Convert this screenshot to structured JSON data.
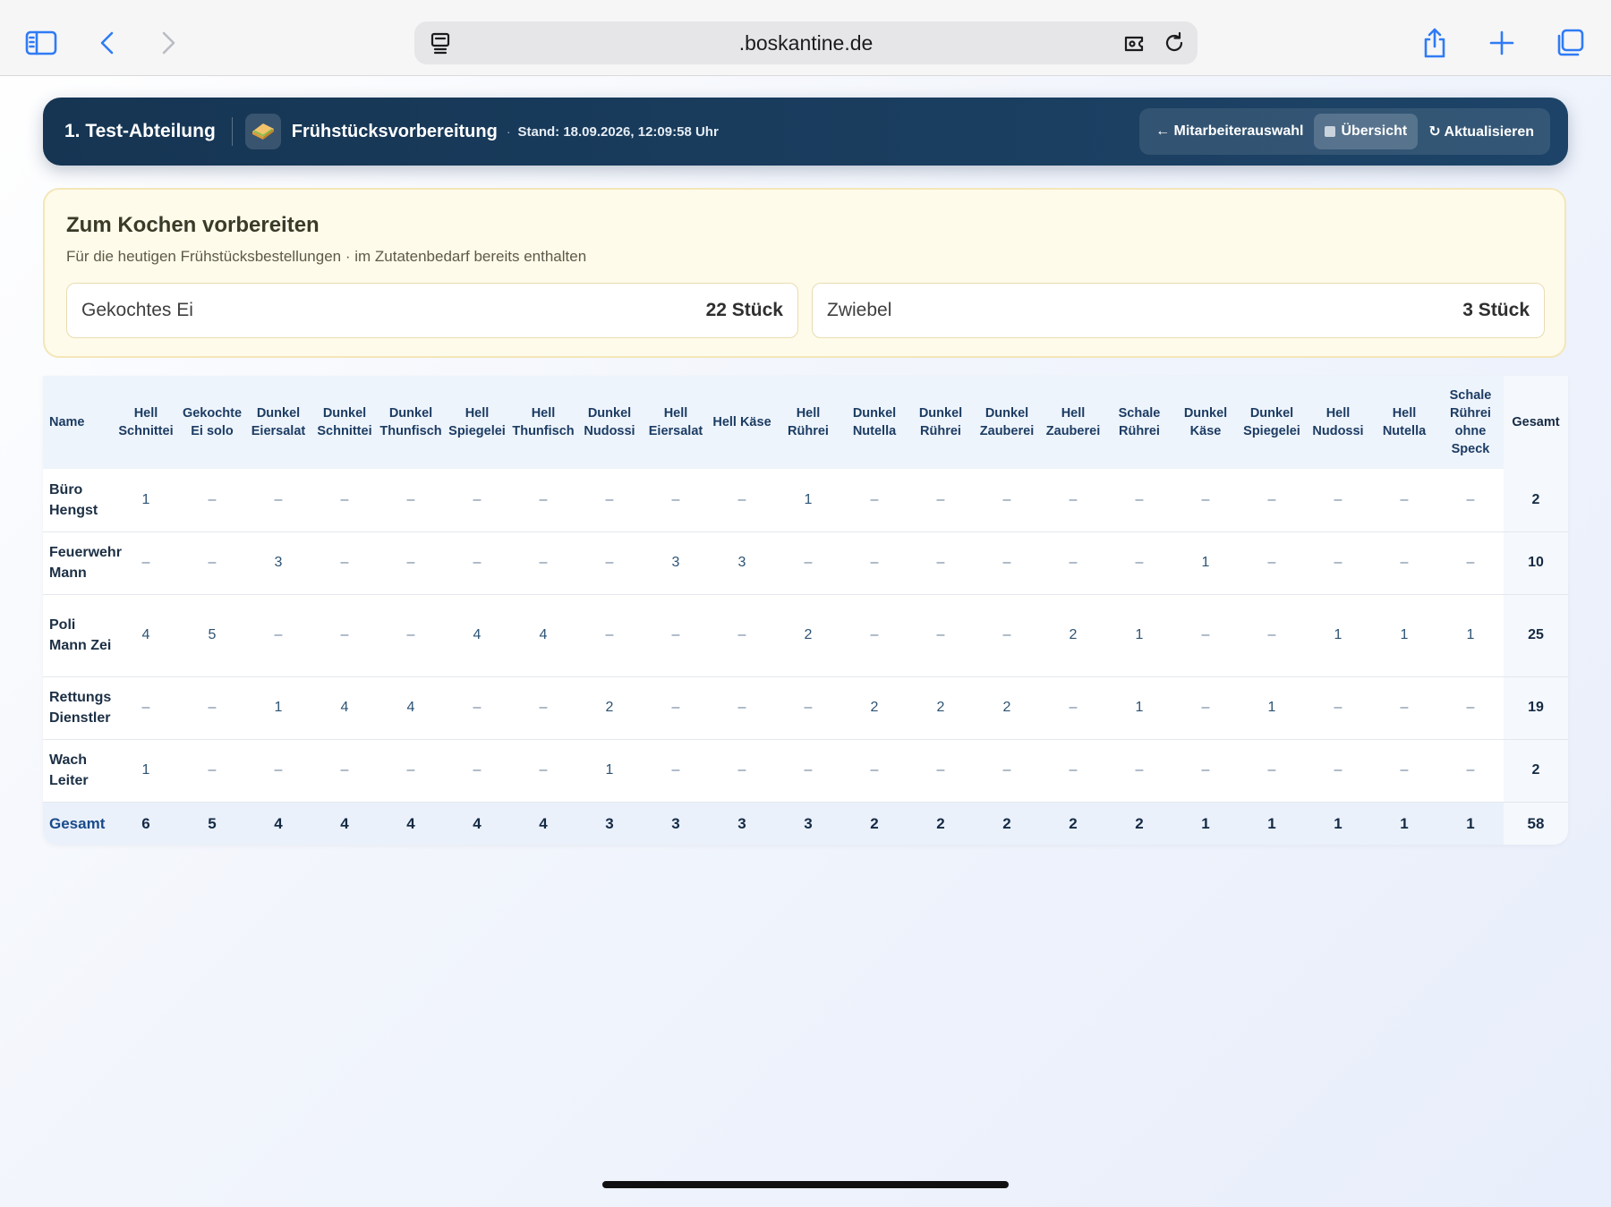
{
  "browser": {
    "url": ".boskantine.de"
  },
  "header": {
    "department": "1. Test-Abteilung",
    "emoji": "🥪",
    "title": "Frühstücksvorbereitung",
    "separator": "·",
    "stand": "Stand: 18.09.2026, 12:09:58 Uhr",
    "buttons": {
      "employee_select": "← Mitarbeiterauswahl",
      "overview": "Übersicht",
      "refresh": "↻ Aktualisieren"
    }
  },
  "prep": {
    "title": "Zum Kochen vorbereiten",
    "subtitle": "Für die heutigen Frühstücksbestellungen · im Zutatenbedarf bereits enthalten",
    "items": [
      {
        "name": "Gekochtes Ei",
        "qty": "22 Stück"
      },
      {
        "name": "Zwiebel",
        "qty": "3 Stück"
      }
    ]
  },
  "table": {
    "name_header": "Name",
    "total_header": "Gesamt",
    "columns": [
      "Hell Schnittei",
      "Gekochte Ei solo",
      "Dunkel Eiersalat",
      "Dunkel Schnittei",
      "Dunkel Thunfisch",
      "Hell Spiegelei",
      "Hell Thunfisch",
      "Dunkel Nudossi",
      "Hell Eiersalat",
      "Hell Käse",
      "Hell Rührei",
      "Dunkel Nutella",
      "Dunkel Rührei",
      "Dunkel Zauberei",
      "Hell Zauberei",
      "Schale Rührei",
      "Dunkel Käse",
      "Dunkel Spiegelei",
      "Hell Nudossi",
      "Hell Nutella",
      "Schale Rührei ohne Speck"
    ],
    "rows": [
      {
        "name": "Büro Hengst",
        "cells": [
          "1",
          "–",
          "–",
          "–",
          "–",
          "–",
          "–",
          "–",
          "–",
          "–",
          "1",
          "–",
          "–",
          "–",
          "–",
          "–",
          "–",
          "–",
          "–",
          "–",
          "–"
        ],
        "total": "2"
      },
      {
        "name": "Feuerwehr Mann",
        "cells": [
          "–",
          "–",
          "3",
          "–",
          "–",
          "–",
          "–",
          "–",
          "3",
          "3",
          "–",
          "–",
          "–",
          "–",
          "–",
          "–",
          "1",
          "–",
          "–",
          "–",
          "–"
        ],
        "total": "10"
      },
      {
        "name": "Poli Mann Zei",
        "cells": [
          "4",
          "5",
          "–",
          "–",
          "–",
          "4",
          "4",
          "–",
          "–",
          "–",
          "2",
          "–",
          "–",
          "–",
          "2",
          "1",
          "–",
          "–",
          "1",
          "1",
          "1"
        ],
        "total": "25"
      },
      {
        "name": "Rettungs Dienstler",
        "cells": [
          "–",
          "–",
          "1",
          "4",
          "4",
          "–",
          "–",
          "2",
          "–",
          "–",
          "–",
          "2",
          "2",
          "2",
          "–",
          "1",
          "–",
          "1",
          "–",
          "–",
          "–"
        ],
        "total": "19"
      },
      {
        "name": "Wach Leiter",
        "cells": [
          "1",
          "–",
          "–",
          "–",
          "–",
          "–",
          "–",
          "1",
          "–",
          "–",
          "–",
          "–",
          "–",
          "–",
          "–",
          "–",
          "–",
          "–",
          "–",
          "–",
          "–"
        ],
        "total": "2"
      }
    ],
    "footer": {
      "label": "Gesamt",
      "cells": [
        "6",
        "5",
        "4",
        "4",
        "4",
        "4",
        "4",
        "3",
        "3",
        "3",
        "3",
        "2",
        "2",
        "2",
        "2",
        "2",
        "1",
        "1",
        "1",
        "1",
        "1"
      ],
      "total": "58"
    }
  }
}
